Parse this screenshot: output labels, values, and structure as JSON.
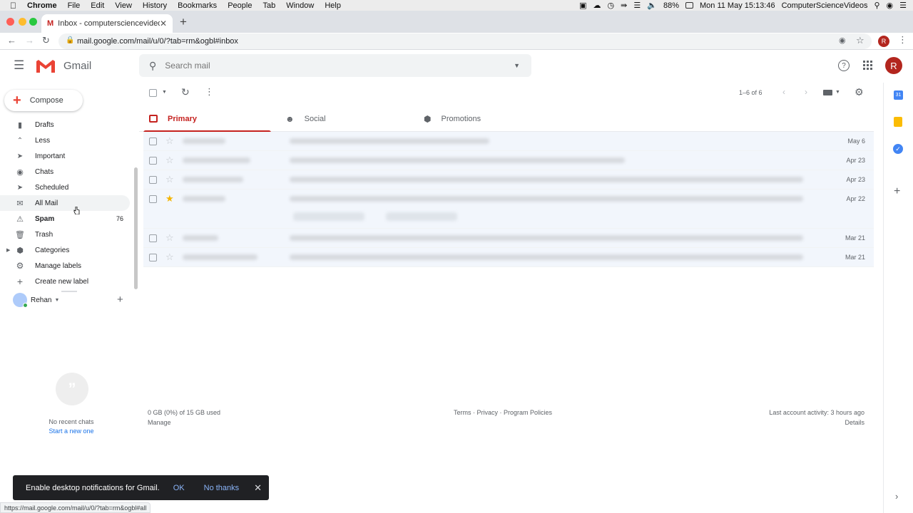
{
  "menubar": {
    "items": [
      "Chrome",
      "File",
      "Edit",
      "View",
      "History",
      "Bookmarks",
      "People",
      "Tab",
      "Window",
      "Help"
    ],
    "battery": "88%",
    "clock": "Mon 11 May  15:13:46",
    "user": "ComputerScienceVideos"
  },
  "browser": {
    "tab_title": "Inbox - computersciencevideo",
    "url": "mail.google.com/mail/u/0/?tab=rm&ogbl#inbox",
    "profile_initial": "R"
  },
  "gmail": {
    "logo_text": "Gmail",
    "search_placeholder": "Search mail",
    "avatar_initial": "R",
    "compose_label": "Compose",
    "pager": "1–6 of 6"
  },
  "sidebar": {
    "items": [
      {
        "label": "Drafts",
        "count": "",
        "icon": "draft-icon"
      },
      {
        "label": "Less",
        "count": "",
        "icon": "chevron-up-icon"
      },
      {
        "label": "Important",
        "count": "",
        "icon": "important-icon"
      },
      {
        "label": "Chats",
        "count": "",
        "icon": "chat-icon"
      },
      {
        "label": "Scheduled",
        "count": "",
        "icon": "scheduled-icon"
      },
      {
        "label": "All Mail",
        "count": "",
        "icon": "mail-icon"
      },
      {
        "label": "Spam",
        "count": "76",
        "icon": "spam-icon"
      },
      {
        "label": "Trash",
        "count": "",
        "icon": "trash-icon"
      },
      {
        "label": "Categories",
        "count": "",
        "icon": "label-icon"
      },
      {
        "label": "Manage labels",
        "count": "",
        "icon": "gear-icon"
      },
      {
        "label": "Create new label",
        "count": "",
        "icon": "plus-icon"
      }
    ],
    "hangouts_user": "Rehan",
    "no_chats": "No recent chats",
    "start_new": "Start a new one"
  },
  "tabs": [
    {
      "label": "Primary",
      "icon": "inbox-icon"
    },
    {
      "label": "Social",
      "icon": "people-icon"
    },
    {
      "label": "Promotions",
      "icon": "tag-icon"
    }
  ],
  "mails": [
    {
      "date": "May 6",
      "starred": false
    },
    {
      "date": "Apr 23",
      "starred": false
    },
    {
      "date": "Apr 23",
      "starred": false
    },
    {
      "date": "Apr 22",
      "starred": true
    },
    {
      "date": "Mar 21",
      "starred": false
    },
    {
      "date": "Mar 21",
      "starred": false
    }
  ],
  "footer": {
    "storage": "0 GB (0%) of 15 GB used",
    "manage": "Manage",
    "links": "Terms · Privacy · Program Policies",
    "activity": "Last account activity: 3 hours ago",
    "details": "Details"
  },
  "snackbar": {
    "message": "Enable desktop notifications for Gmail.",
    "ok": "OK",
    "no_thanks": "No thanks"
  },
  "status_url": "https://mail.google.com/mail/u/0/?tab=rm&ogbl#all",
  "colors": {
    "gmail_red": "#c5221f",
    "avatar": "#b3261e",
    "star": "#f4b400"
  }
}
